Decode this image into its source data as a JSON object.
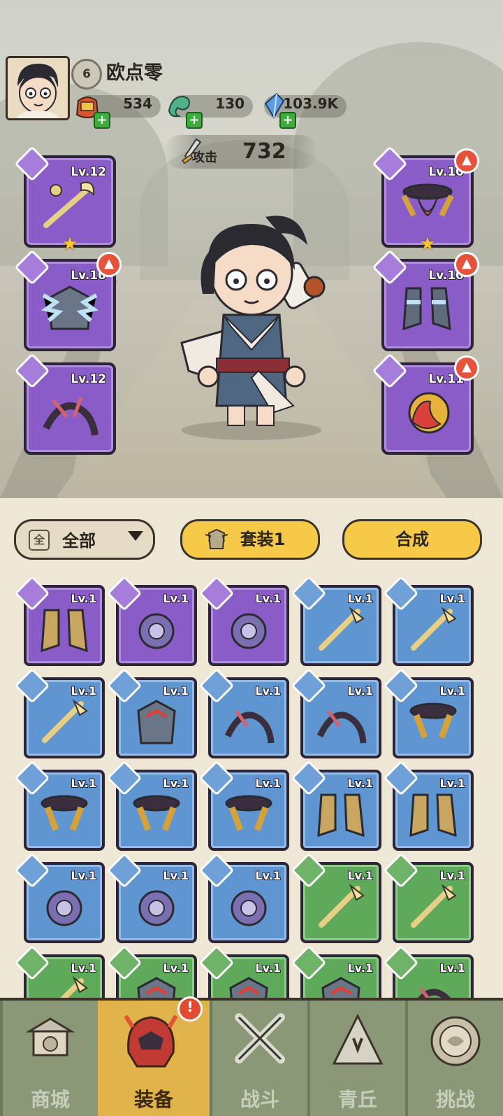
{
  "player": {
    "level": "6",
    "name": "欧点零"
  },
  "resources": [
    {
      "icon": "gold-pouch-icon",
      "value": "534"
    },
    {
      "icon": "jade-dragon-icon",
      "value": "130"
    },
    {
      "icon": "crystal-icon",
      "value": "103.9K"
    }
  ],
  "stats": {
    "attack_label": "攻击",
    "attack_value": "732"
  },
  "equipped": {
    "left": [
      {
        "slot": "weapon",
        "level": "Lv.12",
        "upgrade": false,
        "star": true
      },
      {
        "slot": "armor",
        "level": "Lv.10",
        "upgrade": true,
        "star": false
      },
      {
        "slot": "bracer",
        "level": "Lv.12",
        "upgrade": false,
        "star": false
      }
    ],
    "right": [
      {
        "slot": "belt",
        "level": "Lv.10",
        "upgrade": true,
        "star": true
      },
      {
        "slot": "boots",
        "level": "Lv.10",
        "upgrade": true,
        "star": false
      },
      {
        "slot": "amulet",
        "level": "Lv.11",
        "upgrade": true,
        "star": false
      }
    ]
  },
  "filter": {
    "icon_char": "全",
    "label": "全部"
  },
  "buttons": {
    "set_label": "套装1",
    "compose_label": "合成"
  },
  "inventory": [
    {
      "rarity": "purple",
      "slot": "boots",
      "level": "Lv.1"
    },
    {
      "rarity": "purple",
      "slot": "amulet",
      "level": "Lv.1"
    },
    {
      "rarity": "purple",
      "slot": "amulet",
      "level": "Lv.1"
    },
    {
      "rarity": "blue",
      "slot": "weapon",
      "level": "Lv.1"
    },
    {
      "rarity": "blue",
      "slot": "weapon",
      "level": "Lv.1"
    },
    {
      "rarity": "blue",
      "slot": "weapon",
      "level": "Lv.1"
    },
    {
      "rarity": "blue",
      "slot": "armor",
      "level": "Lv.1"
    },
    {
      "rarity": "blue",
      "slot": "bracer",
      "level": "Lv.1"
    },
    {
      "rarity": "blue",
      "slot": "bracer",
      "level": "Lv.1"
    },
    {
      "rarity": "blue",
      "slot": "belt",
      "level": "Lv.1"
    },
    {
      "rarity": "blue",
      "slot": "belt",
      "level": "Lv.1"
    },
    {
      "rarity": "blue",
      "slot": "belt",
      "level": "Lv.1"
    },
    {
      "rarity": "blue",
      "slot": "belt",
      "level": "Lv.1"
    },
    {
      "rarity": "blue",
      "slot": "boots",
      "level": "Lv.1"
    },
    {
      "rarity": "blue",
      "slot": "boots",
      "level": "Lv.1"
    },
    {
      "rarity": "blue",
      "slot": "amulet",
      "level": "Lv.1"
    },
    {
      "rarity": "blue",
      "slot": "amulet",
      "level": "Lv.1"
    },
    {
      "rarity": "blue",
      "slot": "amulet",
      "level": "Lv.1"
    },
    {
      "rarity": "green",
      "slot": "weapon",
      "level": "Lv.1"
    },
    {
      "rarity": "green",
      "slot": "weapon",
      "level": "Lv.1"
    },
    {
      "rarity": "green",
      "slot": "weapon",
      "level": "Lv.1"
    },
    {
      "rarity": "green",
      "slot": "armor",
      "level": "Lv.1"
    },
    {
      "rarity": "green",
      "slot": "armor",
      "level": "Lv.1"
    },
    {
      "rarity": "green",
      "slot": "armor",
      "level": "Lv.1"
    },
    {
      "rarity": "green",
      "slot": "bracer",
      "level": "Lv.1"
    }
  ],
  "nav": [
    {
      "label": "商城",
      "icon": "shop-icon",
      "active": false
    },
    {
      "label": "装备",
      "icon": "equipment-helmet-icon",
      "active": true,
      "alert": "!"
    },
    {
      "label": "战斗",
      "icon": "crossed-swords-icon",
      "active": false
    },
    {
      "label": "青丘",
      "icon": "mountain-icon",
      "active": false
    },
    {
      "label": "挑战",
      "icon": "challenge-orb-icon",
      "active": false
    }
  ],
  "colors": {
    "purple": "#8a5cc8",
    "blue": "#5f95d1",
    "green": "#5ea95a",
    "accent": "#f6c948",
    "nav": "#8a9878",
    "nav_active": "#e0b34b"
  }
}
